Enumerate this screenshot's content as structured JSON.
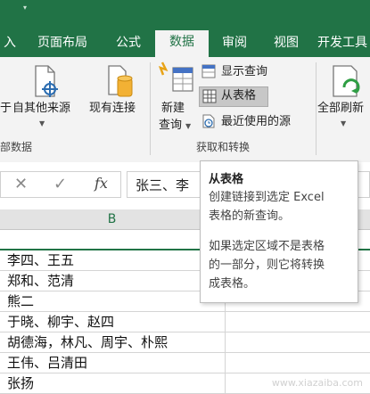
{
  "tabs": [
    {
      "label": "入",
      "active": false
    },
    {
      "label": "页面布局",
      "active": false
    },
    {
      "label": "公式",
      "active": false
    },
    {
      "label": "数据",
      "active": true
    },
    {
      "label": "审阅",
      "active": false
    },
    {
      "label": "视图",
      "active": false
    },
    {
      "label": "开发工具",
      "active": false
    }
  ],
  "ribbon": {
    "from_other_sources": "自其他来源",
    "left_cut": "于",
    "existing_connections": "现有连接",
    "group_get_external_cut": "部数据",
    "new_query_line1": "新建",
    "new_query_line2": "查询",
    "show_queries": "显示查询",
    "from_table": "从表格",
    "recent_sources": "最近使用的源",
    "group_get_transform": "获取和转换",
    "refresh_all": "全部刷新"
  },
  "formula_bar": {
    "fx": "fx",
    "value": "张三、李"
  },
  "column_header": "B",
  "rows": [
    "李四、王五",
    "郑和、范清",
    "熊二",
    "于晓、柳宇、赵四",
    "胡德海，林凡、周宇、朴熙",
    "王伟、吕清田",
    "张扬"
  ],
  "tooltip": {
    "title": "从表格",
    "line1": "创建链接到选定 Excel",
    "line2": "表格的新查询。",
    "line3": "如果选定区域不是表格",
    "line4": "的一部分，则它将转换",
    "line5": "成表格。"
  },
  "watermark": "www.xiazaiba.com",
  "colors": {
    "brand": "#217346",
    "ribbon": "#f3f3f3"
  }
}
